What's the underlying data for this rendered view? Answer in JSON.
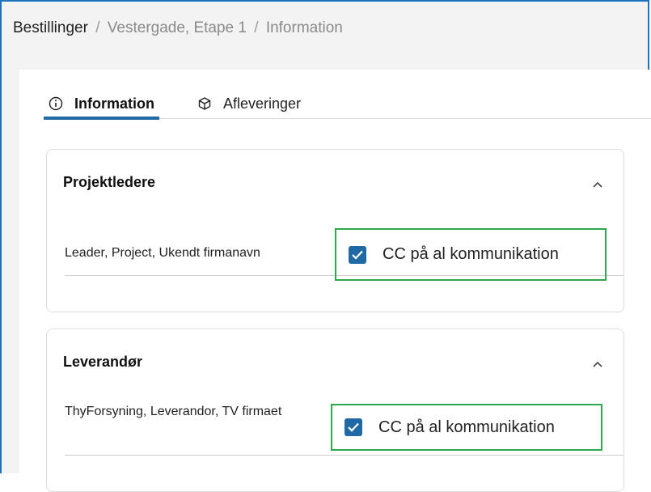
{
  "breadcrumb": {
    "root": "Bestillinger",
    "separator": "/",
    "project": "Vestergade, Etape 1",
    "current": "Information"
  },
  "tabs": [
    {
      "label": "Information",
      "icon": "info-icon",
      "active": true
    },
    {
      "label": "Afleveringer",
      "icon": "cube-icon",
      "active": false
    }
  ],
  "sections": [
    {
      "title": "Projektledere",
      "expanded": true,
      "row": {
        "name": "Leader, Project, Ukendt firmanavn",
        "cc_label": "CC på al kommunikation",
        "cc_checked": true
      }
    },
    {
      "title": "Leverandør",
      "expanded": true,
      "row": {
        "name": "ThyForsyning, Leverandor, TV firmaet",
        "cc_label": "CC på al kommunikation",
        "cc_checked": true
      }
    }
  ],
  "colors": {
    "accent": "#1f6aa5",
    "highlight": "#2ea84f",
    "window_border": "#1e73be"
  }
}
